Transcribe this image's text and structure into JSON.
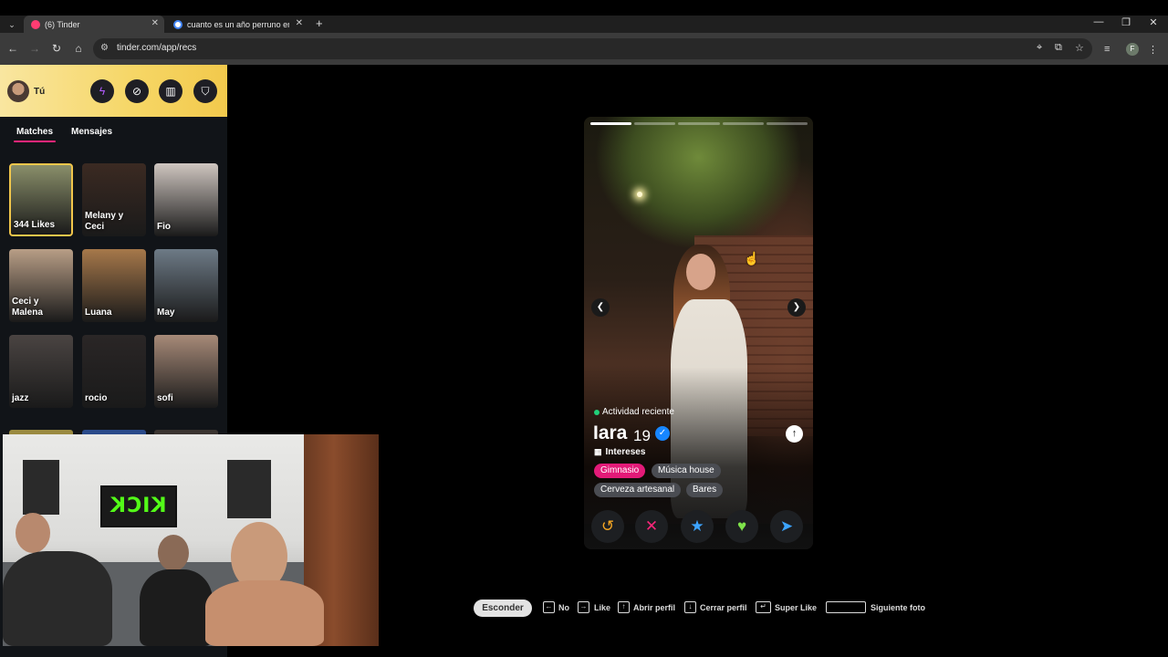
{
  "browser": {
    "tabs": [
      {
        "title": "(6) Tinder",
        "favicon_color": "#fe3c72",
        "active": true
      },
      {
        "title": "cuanto es un año perruno en h",
        "favicon_color": "#ffffff",
        "active": false
      }
    ],
    "url": "tinder.com/app/recs",
    "profile_initial": "F"
  },
  "sidebar": {
    "user_label": "Tú",
    "header_buttons": [
      "boost-icon",
      "explore-icon",
      "briefcase-icon",
      "shield-icon"
    ],
    "tabs": [
      "Matches",
      "Mensajes"
    ],
    "matches": [
      {
        "name": "344 Likes",
        "bg": "#8a8f6a"
      },
      {
        "name": "Melany y Ceci",
        "bg": "#3b2a22"
      },
      {
        "name": "Fio",
        "bg": "#cfc6c0"
      },
      {
        "name": "Ceci y Malena",
        "bg": "#b89e86"
      },
      {
        "name": "Luana",
        "bg": "#a6784a"
      },
      {
        "name": "May",
        "bg": "#6d7a86"
      },
      {
        "name": "jazz",
        "bg": "#4a4442"
      },
      {
        "name": "rocio",
        "bg": "#2a2626"
      },
      {
        "name": "sofi",
        "bg": "#a78a78"
      }
    ]
  },
  "webcam": {
    "kick_text": "KICK"
  },
  "profile": {
    "activity": "Actividad reciente",
    "name": "Iara",
    "age": "19",
    "interests_title": "Intereses",
    "interests": [
      "Gimnasio",
      "Música house",
      "Cerveza artesanal",
      "Bares"
    ],
    "photo_count": 5,
    "current_photo": 1
  },
  "actions": [
    {
      "name": "rewind",
      "glyph": "↺",
      "color": "#f5a623"
    },
    {
      "name": "nope",
      "glyph": "✕",
      "color": "#fd267a"
    },
    {
      "name": "super-like",
      "glyph": "★",
      "color": "#3ca4ff"
    },
    {
      "name": "like",
      "glyph": "♥",
      "color": "#7ee34a"
    },
    {
      "name": "boost",
      "glyph": "➤",
      "color": "#3ca4ff"
    }
  ],
  "shortcuts": {
    "hide": "Esconder",
    "no": "No",
    "like": "Like",
    "open_profile": "Abrir perfil",
    "close_profile": "Cerrar perfil",
    "super_like": "Super Like",
    "next_photo": "Siguiente foto"
  }
}
